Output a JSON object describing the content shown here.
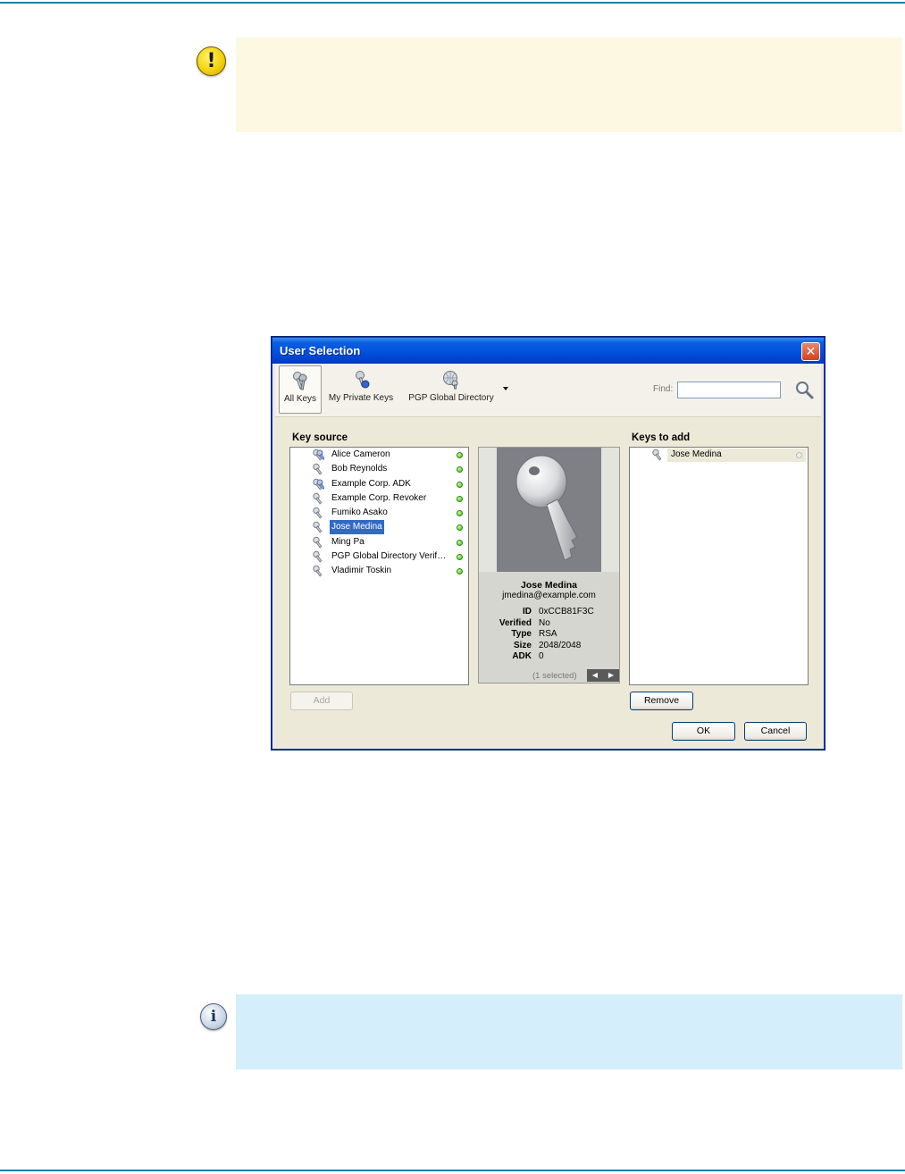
{
  "warning": {
    "icon": "warning-icon",
    "color": "#fdf8e2"
  },
  "note": {
    "icon": "info-icon",
    "color": "#d4eefb"
  },
  "dialog": {
    "title": "User Selection",
    "close_glyph": "✕",
    "toolbar": {
      "all_keys": "All Keys",
      "my_private_keys": "My Private Keys",
      "pgp_global_directory": "PGP Global Directory",
      "find_label": "Find:",
      "find_value": ""
    },
    "key_source": {
      "label": "Key source",
      "items": [
        {
          "name": "Alice Cameron",
          "icon": "key-pair-icon"
        },
        {
          "name": "Bob Reynolds",
          "icon": "key-icon"
        },
        {
          "name": "Example Corp. ADK",
          "icon": "key-pair-icon"
        },
        {
          "name": "Example Corp. Revoker",
          "icon": "key-icon"
        },
        {
          "name": "Fumiko Asako",
          "icon": "key-icon"
        },
        {
          "name": "Jose Medina",
          "icon": "key-icon",
          "selected": true
        },
        {
          "name": "Ming Pa",
          "icon": "key-icon"
        },
        {
          "name": "PGP Global Directory Verif…",
          "icon": "key-icon"
        },
        {
          "name": "Vladimir Toskin",
          "icon": "key-icon"
        }
      ]
    },
    "details": {
      "name": "Jose Medina",
      "email": "jmedina@example.com",
      "props": [
        {
          "label": "ID",
          "value": "0xCCB81F3C"
        },
        {
          "label": "Verified",
          "value": "No"
        },
        {
          "label": "Type",
          "value": "RSA"
        },
        {
          "label": "Size",
          "value": "2048/2048"
        },
        {
          "label": "ADK",
          "value": "0"
        }
      ],
      "count": "(1 selected)"
    },
    "keys_to_add": {
      "label": "Keys to add",
      "items": [
        {
          "name": "Jose Medina",
          "icon": "key-icon"
        }
      ]
    },
    "buttons": {
      "add": "Add",
      "remove": "Remove",
      "ok": "OK",
      "cancel": "Cancel"
    }
  }
}
